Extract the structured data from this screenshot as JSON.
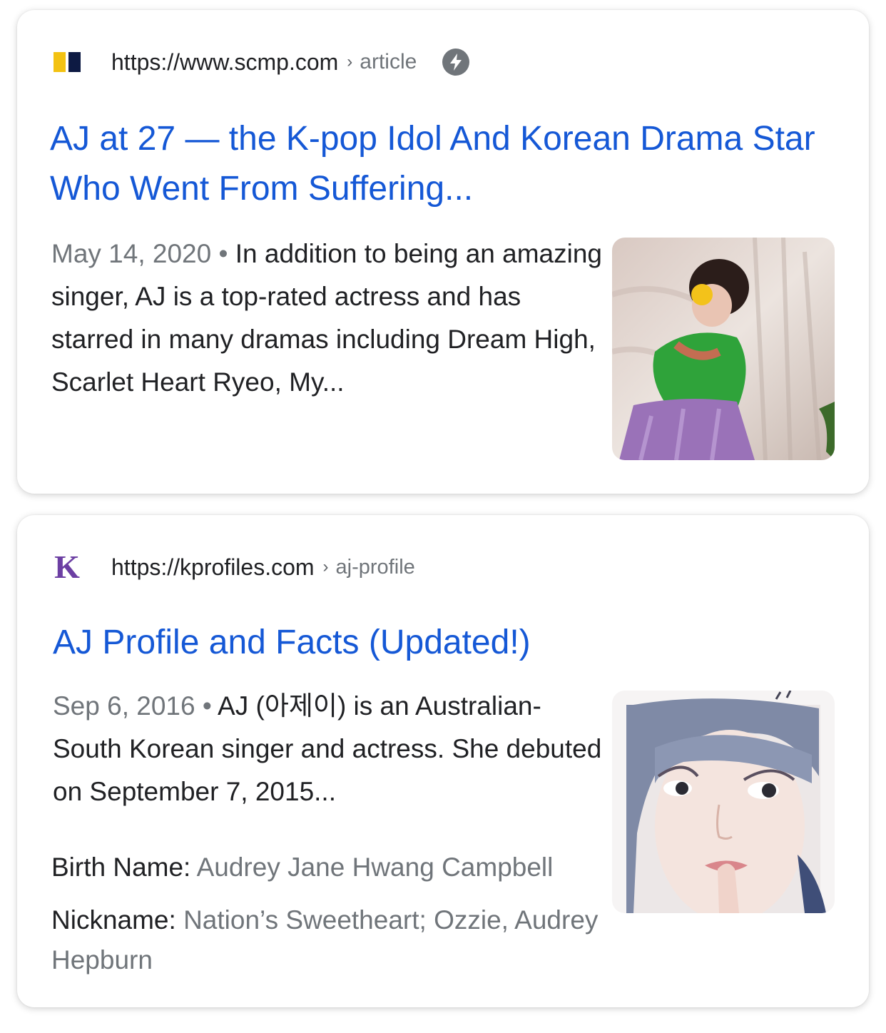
{
  "results": [
    {
      "site_url": "https://www.scmp.com",
      "breadcrumb_sep": "›",
      "breadcrumb": "article",
      "favicon_icon": "scmp-logo-icon",
      "amp_icon": "amp-lightning-icon",
      "title": "AJ at 27 — the K-pop Idol And Korean Drama Star Who Went From Suffering...",
      "date": "May 14, 2020",
      "bullet": " • ",
      "snippet": "In addition to being an amazing singer, AJ is a top-rated actress and has starred in many dramas including Dream High, Scarlet Heart Ryeo, My...",
      "thumbnail_icon": "woman-green-dress-photo"
    },
    {
      "site_url": "https://kprofiles.com",
      "breadcrumb_sep": "›",
      "breadcrumb": "aj-profile",
      "favicon_icon": "kprofiles-logo-icon",
      "favicon_letter": "K",
      "title": "AJ Profile and Facts (Updated!)",
      "date": "Sep 6, 2016",
      "bullet": " • ",
      "snippet": "AJ (아제이) is an Australian-South Korean singer and actress. She debuted on September 7, 2015...",
      "thumbnail_icon": "woman-portrait-photo",
      "facts": [
        {
          "label": "Birth Name:",
          "value": "Audrey Jane Hwang Campbell"
        },
        {
          "label": "Nickname:",
          "value": "Nation’s Sweetheart; Ozzie, Audrey Hepburn"
        }
      ]
    }
  ],
  "colors": {
    "title_link": "#1558d6",
    "secondary_text": "#70757a",
    "primary_text": "#202124",
    "scmp_yellow": "#f3c212",
    "scmp_navy": "#0d1a43",
    "kprofiles_purple": "#6c3fa3"
  }
}
